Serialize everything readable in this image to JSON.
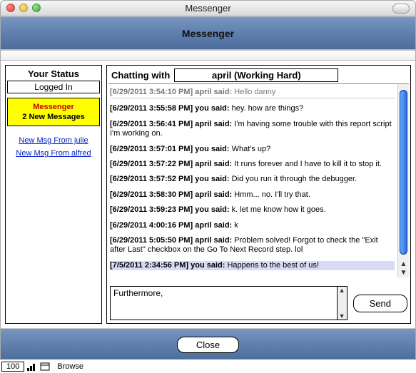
{
  "window": {
    "title": "Messenger"
  },
  "header": {
    "title": "Messenger"
  },
  "sidebar": {
    "status_title": "Your Status",
    "status_value": "Logged In",
    "alert_line1": "Messenger",
    "alert_line2": "2 New Messages",
    "links": [
      {
        "label": "New Msg From julie"
      },
      {
        "label": "New Msg From alfred"
      }
    ]
  },
  "chat": {
    "header_prefix": "Chatting with",
    "partner_display": "april (Working Hard)",
    "messages": [
      {
        "ts": "[6/29/2011 3:54:10 PM]",
        "who": "april said:",
        "text": "Hello danny",
        "cut": true
      },
      {
        "ts": "[6/29/2011 3:55:58 PM]",
        "who": "you said:",
        "text": "hey. how are things?"
      },
      {
        "ts": "[6/29/2011 3:56:41 PM]",
        "who": "april said:",
        "text": "I'm having some trouble with this report script I'm working on."
      },
      {
        "ts": "[6/29/2011 3:57:01 PM]",
        "who": "you said:",
        "text": "What's up?"
      },
      {
        "ts": "[6/29/2011 3:57:22 PM]",
        "who": "april said:",
        "text": "It runs forever and I have to kill it to stop it."
      },
      {
        "ts": "[6/29/2011 3:57:52 PM]",
        "who": "you said:",
        "text": "Did you run it through the debugger."
      },
      {
        "ts": "[6/29/2011 3:58:30 PM]",
        "who": "april said:",
        "text": "Hmm... no. I'll try that."
      },
      {
        "ts": "[6/29/2011 3:59:23 PM]",
        "who": "you said:",
        "text": "k. let me know how it goes."
      },
      {
        "ts": "[6/29/2011 4:00:16 PM]",
        "who": "april said:",
        "text": "k"
      },
      {
        "ts": "[6/29/2011 5:05:50 PM]",
        "who": "april said:",
        "text": "Problem solved! Forgot to check the \"Exit after Last\" checkbox on the Go To Next Record step. lol"
      },
      {
        "ts": "[7/5/2011 2:34:56 PM]",
        "who": "you said:",
        "text": "Happens to the best of us!",
        "selected": true
      }
    ]
  },
  "compose": {
    "value": "Furthermore,",
    "send_label": "Send"
  },
  "footer": {
    "close_label": "Close"
  },
  "statusbar": {
    "zoom": "100",
    "mode": "Browse"
  }
}
